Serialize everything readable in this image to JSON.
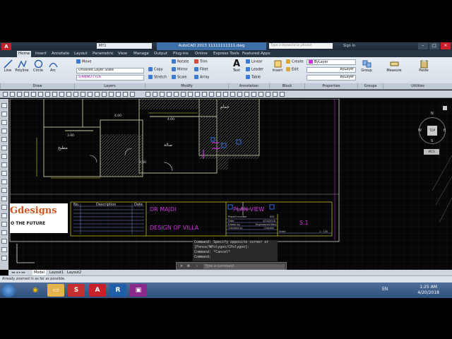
{
  "titlebar": {
    "workspace": "MY1",
    "doc_title": "AutoCAD 2013  11111111111.dwg",
    "search_placeholder": "Type a keyword or phrase",
    "sign_in": "Sign In"
  },
  "ribbon_tabs": [
    "Home",
    "Insert",
    "Annotate",
    "Layout",
    "Parametric",
    "View",
    "Manage",
    "Output",
    "Plug-ins",
    "Online",
    "Express Tools",
    "Featured Apps"
  ],
  "ribbon": {
    "draw_tools": [
      "Line",
      "Polyline",
      "Circle",
      "Arc"
    ],
    "modify_tools": [
      "Move",
      "Rotate",
      "Trim",
      "Copy",
      "Mirror",
      "Fillet",
      "Stretch",
      "Scale",
      "Array"
    ],
    "layer_state": "Unsaved Layer State",
    "layer_current": "S-ANNO-TTL6",
    "text_tool": "Text",
    "annotation_tools": [
      "Linear",
      "Leader",
      "Table"
    ],
    "insert_tool": "Insert",
    "block_tools": [
      "Create",
      "Edit"
    ],
    "properties": [
      "ByLayer",
      "ByLayer",
      "ByLayer"
    ],
    "group_tool": "Group",
    "measure_tool": "Measure",
    "paste_tool": "Paste",
    "panels": [
      "Draw",
      "Modify",
      "Layers",
      "Annotation",
      "Block",
      "Properties",
      "Groups",
      "Utilities"
    ]
  },
  "drawing": {
    "labels": [
      "4.00",
      "4.00",
      "3.00",
      "3.00"
    ],
    "arabic_labels": [
      "حمام",
      "صالة",
      "مطبخ"
    ],
    "rev_table_headers": [
      "No.",
      "Description",
      "Date"
    ],
    "owner": "DR MAJDI",
    "project": "DESIGN OF VILLA",
    "sheet_title": "PLAN VIEW",
    "sheet_number": "S.1",
    "small_fields": [
      "Project number",
      "Date",
      "Drawn by",
      "Checked by",
      "Scale"
    ],
    "small_values": [
      "001",
      "4/24/2018",
      "Engineered Mary",
      "Checker",
      "1 : 100"
    ],
    "logo_text": "Gdesigns",
    "logo_tagline": "O THE FUTURE"
  },
  "viewcube": {
    "top": "TOP",
    "n": "N",
    "s": "S",
    "w": "W",
    "e": "E",
    "wcs": "WCS"
  },
  "command": {
    "history": [
      "Command: Specify opposite corner or",
      "[Fence/WPolygon/CPolygon]:",
      "Command: *Cancel*",
      "Command:"
    ],
    "placeholder": "Type a command"
  },
  "layout_tabs": [
    "Model",
    "Layout1",
    "Layout2"
  ],
  "status_text": "Already zoomed in as far as possible.",
  "taskbar": {
    "lang": "EN",
    "time": "1:25 AM",
    "date": "4/20/2018"
  },
  "colors": {
    "accent": "#3e6fa6",
    "magenta": "#d42ee0",
    "ribbon_bg": "#e2e8ef"
  }
}
